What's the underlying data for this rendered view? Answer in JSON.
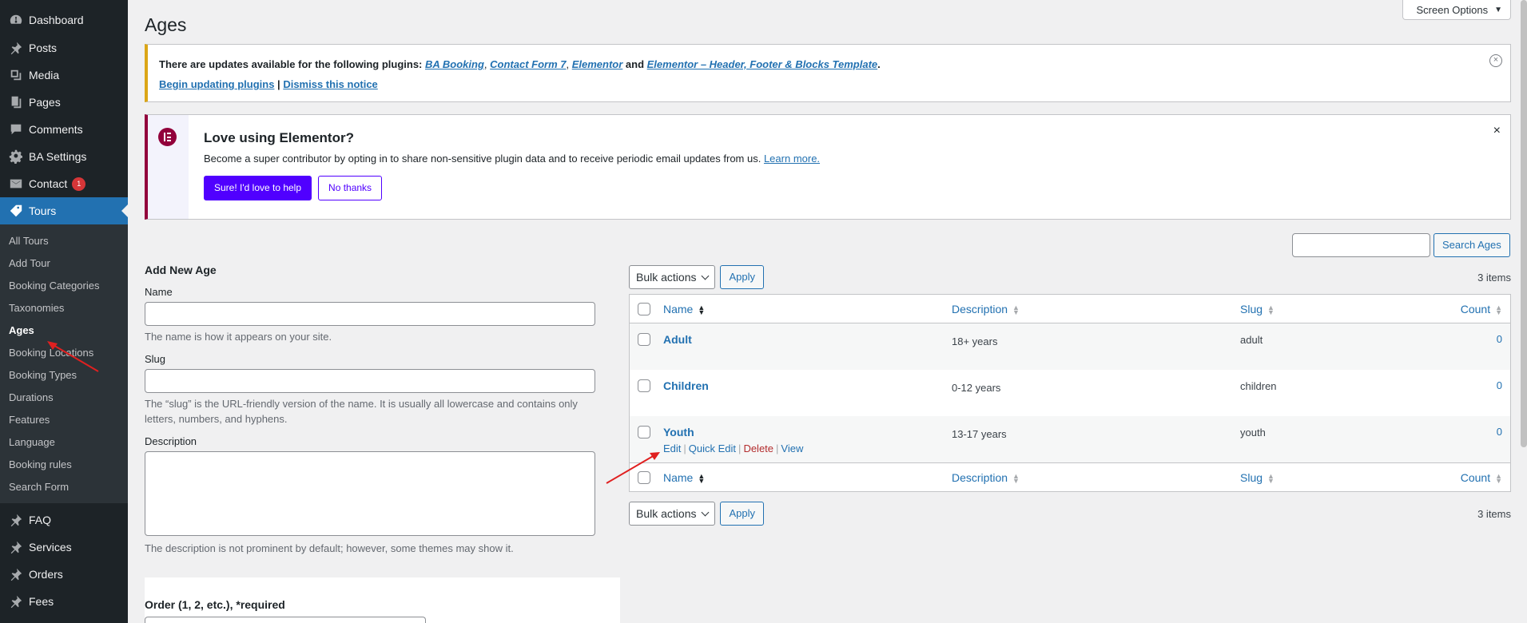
{
  "sidebar": {
    "items": [
      {
        "label": "Dashboard",
        "icon": "dashboard-icon"
      },
      {
        "label": "Posts",
        "icon": "pin-icon"
      },
      {
        "label": "Media",
        "icon": "media-icon"
      },
      {
        "label": "Pages",
        "icon": "pages-icon"
      },
      {
        "label": "Comments",
        "icon": "comments-icon"
      },
      {
        "label": "BA Settings",
        "icon": "gear-icon"
      },
      {
        "label": "Contact",
        "icon": "mail-icon",
        "badge": "1"
      },
      {
        "label": "Tours",
        "icon": "tag-icon",
        "active": true
      }
    ],
    "submenu": [
      "All Tours",
      "Add Tour",
      "Booking Categories",
      "Taxonomies",
      "Ages",
      "Booking Locations",
      "Booking Types",
      "Durations",
      "Features",
      "Language",
      "Booking rules",
      "Search Form"
    ],
    "submenu_current": "Ages",
    "bottom_items": [
      {
        "label": "FAQ",
        "icon": "pin-icon"
      },
      {
        "label": "Services",
        "icon": "pin-icon"
      },
      {
        "label": "Orders",
        "icon": "pin-icon"
      },
      {
        "label": "Fees",
        "icon": "pin-icon"
      }
    ]
  },
  "header": {
    "title": "Ages",
    "screen_options": "Screen Options"
  },
  "update_notice": {
    "prefix": "There are updates available for the following plugins: ",
    "plugin_1": "BA Booking",
    "sep_1": ", ",
    "plugin_2": "Contact Form 7",
    "sep_2": ", ",
    "plugin_3": "Elementor",
    "sep_3": " and ",
    "plugin_4": "Elementor – Header, Footer & Blocks Template",
    "suffix": ".",
    "begin_link": "Begin updating plugins",
    "divider": " | ",
    "dismiss_link": "Dismiss this notice"
  },
  "elementor_notice": {
    "title": "Love using Elementor?",
    "text": "Become a super contributor by opting in to share non-sensitive plugin data and to receive periodic email updates from us. ",
    "learn_more": "Learn more.",
    "primary_button": "Sure! I'd love to help",
    "secondary_button": "No thanks",
    "dismiss": "×"
  },
  "search": {
    "button": "Search Ages",
    "value": ""
  },
  "add_form": {
    "heading": "Add New Age",
    "name_label": "Name",
    "name_help": "The name is how it appears on your site.",
    "slug_label": "Slug",
    "slug_help": "The “slug” is the URL-friendly version of the name. It is usually all lowercase and contains only letters, numbers, and hyphens.",
    "description_label": "Description",
    "description_help": "The description is not prominent by default; however, some themes may show it.",
    "order_label": "Order (1, 2, etc.), *required"
  },
  "tablenav": {
    "bulk_actions": "Bulk actions",
    "apply": "Apply",
    "items_count": "3 items"
  },
  "table": {
    "columns": {
      "name": "Name",
      "description": "Description",
      "slug": "Slug",
      "count": "Count"
    },
    "rows": [
      {
        "name": "Adult",
        "description": "18+ years",
        "slug": "adult",
        "count": "0"
      },
      {
        "name": "Children",
        "description": "0-12 years",
        "slug": "children",
        "count": "0"
      },
      {
        "name": "Youth",
        "description": "13-17 years",
        "slug": "youth",
        "count": "0"
      }
    ],
    "row_actions": {
      "edit": "Edit",
      "quick_edit": "Quick Edit",
      "delete": "Delete",
      "view": "View",
      "sep": "|"
    }
  },
  "colors": {
    "sidebar_bg": "#1d2327",
    "active_menu": "#2271b1",
    "link": "#2271b1",
    "warning_border": "#dba617",
    "elementor_accent": "#92003b",
    "elementor_button": "#5000ff",
    "annotation_arrow": "#e02020"
  }
}
